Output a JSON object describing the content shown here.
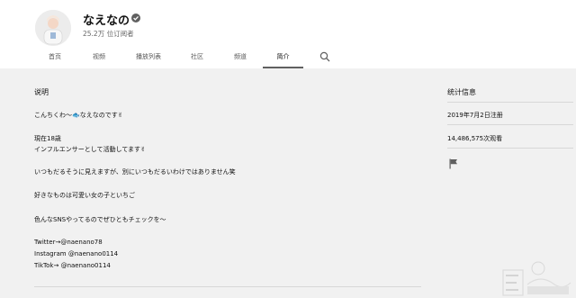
{
  "channel": {
    "name": "なえなの",
    "subscribers": "25.2万 位订阅者"
  },
  "tabs": [
    {
      "label": "首页"
    },
    {
      "label": "视频"
    },
    {
      "label": "播放列表"
    },
    {
      "label": "社区"
    },
    {
      "label": "频道"
    },
    {
      "label": "简介"
    }
  ],
  "active_tab": "简介",
  "description": {
    "title": "说明",
    "lines": [
      "こんちくわ〜🐟なえなのです✌",
      "現在18歳",
      "インフルエンサーとして活動してます✌",
      "いつもだるそうに見えますが、別にいつもだるいわけではありません笑",
      "好きなものは可愛い女の子といちご",
      "色んなSNSやってるのでぜひともチェックを〜",
      "Twitter→@naenano78",
      "Instagram @naenano0114",
      "TikTok→ @naenano0114"
    ]
  },
  "stats": {
    "title": "统计信息",
    "joined": "2019年7月2日注册",
    "views": "14,486,575次观看"
  },
  "icons": {
    "verified": "verified-check-icon",
    "search": "search-icon",
    "flag": "flag-icon"
  },
  "colors": {
    "page_bg": "#f1f1f1",
    "header_bg": "#ffffff",
    "text": "#0f0f0f",
    "secondary_text": "#606060"
  }
}
